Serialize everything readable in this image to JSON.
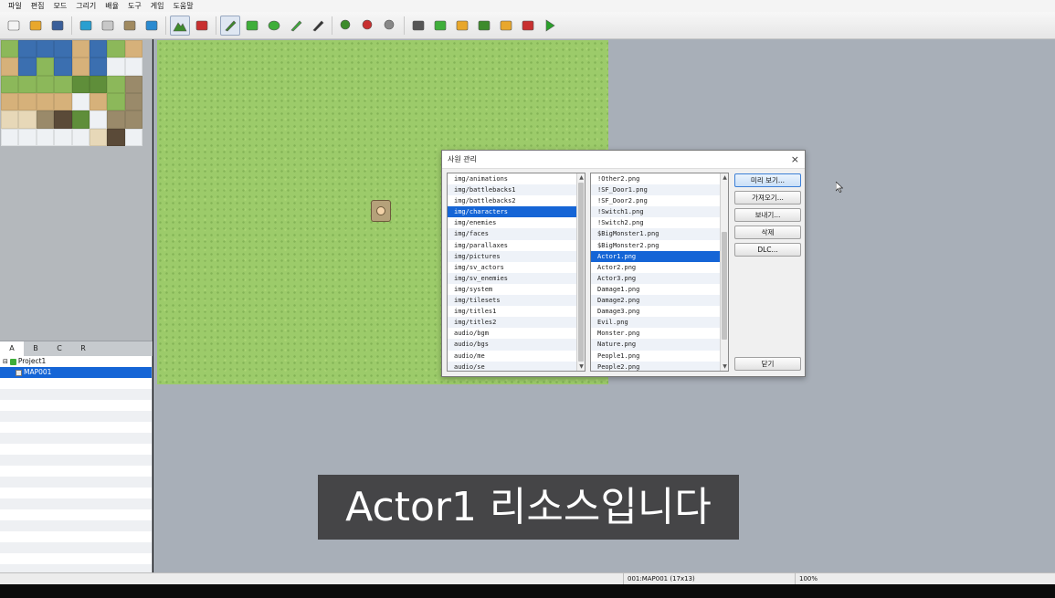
{
  "menu": [
    "파일",
    "편집",
    "모드",
    "그리기",
    "배율",
    "도구",
    "게임",
    "도움말"
  ],
  "toolbar": {
    "buttons": [
      {
        "name": "new-project-icon",
        "color": "#f4f4f4"
      },
      {
        "name": "open-project-icon",
        "color": "#e8a72c"
      },
      {
        "name": "save-project-icon",
        "color": "#3a5f9a"
      },
      {
        "name": "cut-icon",
        "color": "#2a9fd0"
      },
      {
        "name": "copy-icon",
        "color": "#c8c8c8"
      },
      {
        "name": "paste-icon",
        "color": "#a08a60"
      },
      {
        "name": "undo-icon",
        "color": "#2a8ad0"
      },
      {
        "name": "map-mode-icon",
        "color": "#3d8b2c"
      },
      {
        "name": "event-mode-icon",
        "color": "#c83030"
      },
      {
        "name": "pencil-icon",
        "color": "#3d8b2c"
      },
      {
        "name": "rectangle-icon",
        "color": "#3fae3a"
      },
      {
        "name": "ellipse-icon",
        "color": "#3fae3a"
      },
      {
        "name": "fill-icon",
        "color": "#3fae3a"
      },
      {
        "name": "shadow-pen-icon",
        "color": "#333333"
      },
      {
        "name": "zoom-in-icon",
        "color": "#3d8b2c"
      },
      {
        "name": "zoom-out-icon",
        "color": "#c83030"
      },
      {
        "name": "zoom-actual-icon",
        "color": "#888888"
      },
      {
        "name": "database-icon",
        "color": "#555555"
      },
      {
        "name": "plugin-manager-icon",
        "color": "#3fae3a"
      },
      {
        "name": "sound-test-icon",
        "color": "#e8a72c"
      },
      {
        "name": "event-searcher-icon",
        "color": "#3d8b2c"
      },
      {
        "name": "resource-manager-icon",
        "color": "#e8a72c"
      },
      {
        "name": "character-generator-icon",
        "color": "#c83030"
      },
      {
        "name": "playtest-icon",
        "color": "#2aa02a"
      }
    ]
  },
  "palette": {
    "tabs": [
      "A",
      "B",
      "C",
      "R"
    ],
    "active_tab": "A",
    "tiles": [
      "grass",
      "water",
      "water",
      "water",
      "sand",
      "water",
      "grass",
      "sand",
      "sand",
      "water",
      "grass",
      "water",
      "sand",
      "water",
      "snow",
      "snow",
      "grass",
      "grass",
      "grass",
      "grass",
      "tree",
      "tree",
      "grass",
      "rock",
      "sand",
      "sand",
      "sand",
      "sand",
      "snow",
      "sand",
      "grass",
      "rock",
      "light",
      "light",
      "rock",
      "dark",
      "tree",
      "snow",
      "rock",
      "rock",
      "snow",
      "snow",
      "snow",
      "snow",
      "snow",
      "light",
      "dark",
      "snow"
    ]
  },
  "map_tree": {
    "root": "Project1",
    "maps": [
      "MAP001"
    ],
    "selected": "MAP001"
  },
  "dialog": {
    "title": "사원 관리",
    "close_symbol": "×",
    "folders": [
      "img/animations",
      "img/battlebacks1",
      "img/battlebacks2",
      "img/characters",
      "img/enemies",
      "img/faces",
      "img/parallaxes",
      "img/pictures",
      "img/sv_actors",
      "img/sv_enemies",
      "img/system",
      "img/tilesets",
      "img/titles1",
      "img/titles2",
      "audio/bgm",
      "audio/bgs",
      "audio/me",
      "audio/se"
    ],
    "selected_folder": "img/characters",
    "files": [
      "!Other2.png",
      "!SF_Door1.png",
      "!SF_Door2.png",
      "!Switch1.png",
      "!Switch2.png",
      "$BigMonster1.png",
      "$BigMonster2.png",
      "Actor1.png",
      "Actor2.png",
      "Actor3.png",
      "Damage1.png",
      "Damage2.png",
      "Damage3.png",
      "Evil.png",
      "Monster.png",
      "Nature.png",
      "People1.png",
      "People2.png"
    ],
    "selected_file": "Actor1.png",
    "buttons": {
      "preview": "미리 보기...",
      "import": "가져오기...",
      "export": "보내기...",
      "delete": "삭제",
      "dlc": "DLC...",
      "close": "닫기"
    }
  },
  "status": {
    "map_info": "001:MAP001 (17x13)",
    "zoom": "100%"
  },
  "subtitle": "Actor1 리소스입니다"
}
